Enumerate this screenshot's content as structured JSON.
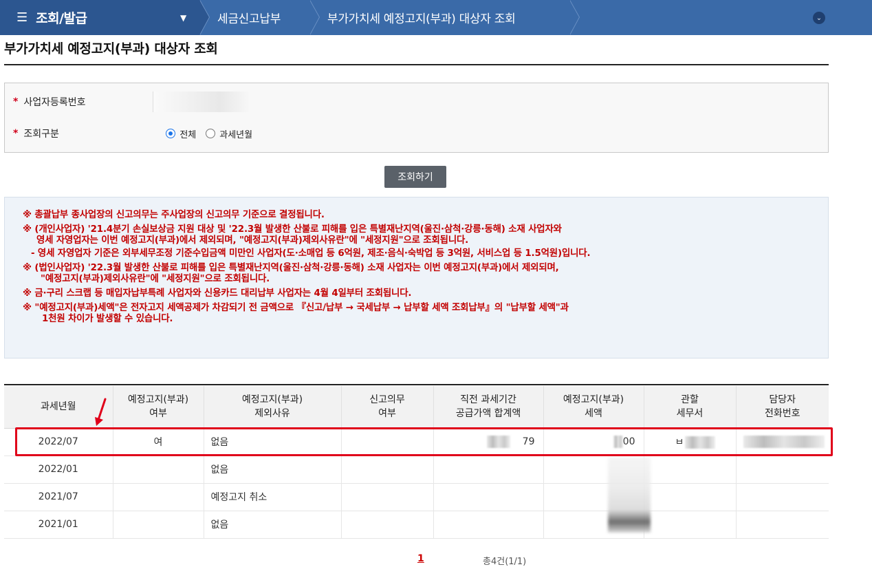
{
  "nav": {
    "menu_title": "조회/발급",
    "crumb_tax": "세금신고납부",
    "crumb_page": "부가가치세 예정고지(부과) 대상자 조회"
  },
  "page": {
    "title": "부가가치세 예정고지(부과) 대상자 조회"
  },
  "form": {
    "bizno_label": "사업자등록번호",
    "query_label": "조회구분",
    "radio_all": "전체",
    "radio_month": "과세년월",
    "selected": "전체",
    "required_mark": "*"
  },
  "search_button": "조회하기",
  "notice": [
    "※ 총괄납부 종사업장의 신고의무는 주사업장의 신고의무 기준으로 결정됩니다.",
    "※ (개인사업자) '21.4분기 손실보상금 지원 대상 및 '22.3월 발생한 산불로 피해를 입은 특별재난지역(울진·삼척·강릉·동해) 소재 사업자와",
    "영세 자영업자는 이번 예정고지(부과)에서 제외되며, \"예정고지(부과)제외사유란\"에 \"세정지원\"으로 조회됩니다.",
    "- 영세 자영업자 기준은 외부세무조정 기준수입금액 미만인 사업자(도·소매업 등 6억원, 제조·음식·숙박업 등 3억원, 서비스업 등 1.5억원)입니다.",
    "※ (법인사업자) '22.3월 발생한 산불로 피해를 입은 특별재난지역(울진·삼척·강릉·동해) 소재 사업자는 이번 예정고지(부과)에서 제외되며,",
    "\"예정고지(부과)제외사유란\"에 \"세정지원\"으로 조회됩니다.",
    "※ 금·구리 스크랩 등 매입자납부특례 사업자와 신용카드 대리납부 사업자는 4월 4일부터 조회됩니다.",
    "※ \"예정고지(부과)세액\"은 전자고지 세액공제가 차감되기 전 금액으로 『신고/납부 → 국세납부 → 납부할 세액 조회납부』의 \"납부할 세액\"과",
    "1천원 차이가 발생할 수 있습니다."
  ],
  "table": {
    "headers": [
      [
        "과세년월"
      ],
      [
        "예정고지(부과)",
        "여부"
      ],
      [
        "예정고지(부과)",
        "제외사유"
      ],
      [
        "신고의무",
        "여부"
      ],
      [
        "직전 과세기간",
        "공급가액 합계액"
      ],
      [
        "예정고지(부과)",
        "세액"
      ],
      [
        "관할",
        "세무서"
      ],
      [
        "담당자",
        "전화번호"
      ]
    ],
    "rows": [
      {
        "period": "2022/07",
        "notice_yn": "여",
        "reason": "없음",
        "duty": "",
        "supply": "79",
        "tax": "00",
        "office": "ㅂ",
        "phone": ""
      },
      {
        "period": "2022/01",
        "notice_yn": "",
        "reason": "없음",
        "duty": "",
        "supply": "",
        "tax": "",
        "office": "",
        "phone": ""
      },
      {
        "period": "2021/07",
        "notice_yn": "",
        "reason": "예정고지 취소",
        "duty": "",
        "supply": "",
        "tax": "",
        "office": "",
        "phone": ""
      },
      {
        "period": "2021/01",
        "notice_yn": "",
        "reason": "없음",
        "duty": "",
        "supply": "",
        "tax": "",
        "office": "",
        "phone": ""
      }
    ]
  },
  "pagination": {
    "current": "1",
    "total": "총4건(1/1)"
  },
  "colors": {
    "nav_bg": "#3a6aa8",
    "nav_dark": "#2c5690",
    "notice_text": "#c20000",
    "highlight": "#e0001a"
  }
}
